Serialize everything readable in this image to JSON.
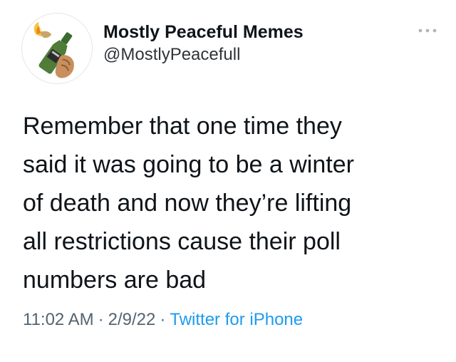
{
  "tweet": {
    "author": {
      "display_name": "Mostly Peaceful Memes",
      "handle": "@MostlyPeacefull",
      "avatar_icon": "molotov-bottle-icon"
    },
    "more_icon": "more-options-icon",
    "text_lines": [
      "Remember that one time they",
      "said it was going to be a winter",
      "of death and now they’re lifting",
      "all restrictions cause their poll",
      "numbers are bad"
    ],
    "meta": {
      "time": "11:02 AM",
      "separator": "·",
      "date": "2/9/22",
      "source": "Twitter for iPhone"
    }
  },
  "colors": {
    "text": "#0f1419",
    "secondary": "#536471",
    "link": "#1d9bf0",
    "background": "#ffffff"
  }
}
